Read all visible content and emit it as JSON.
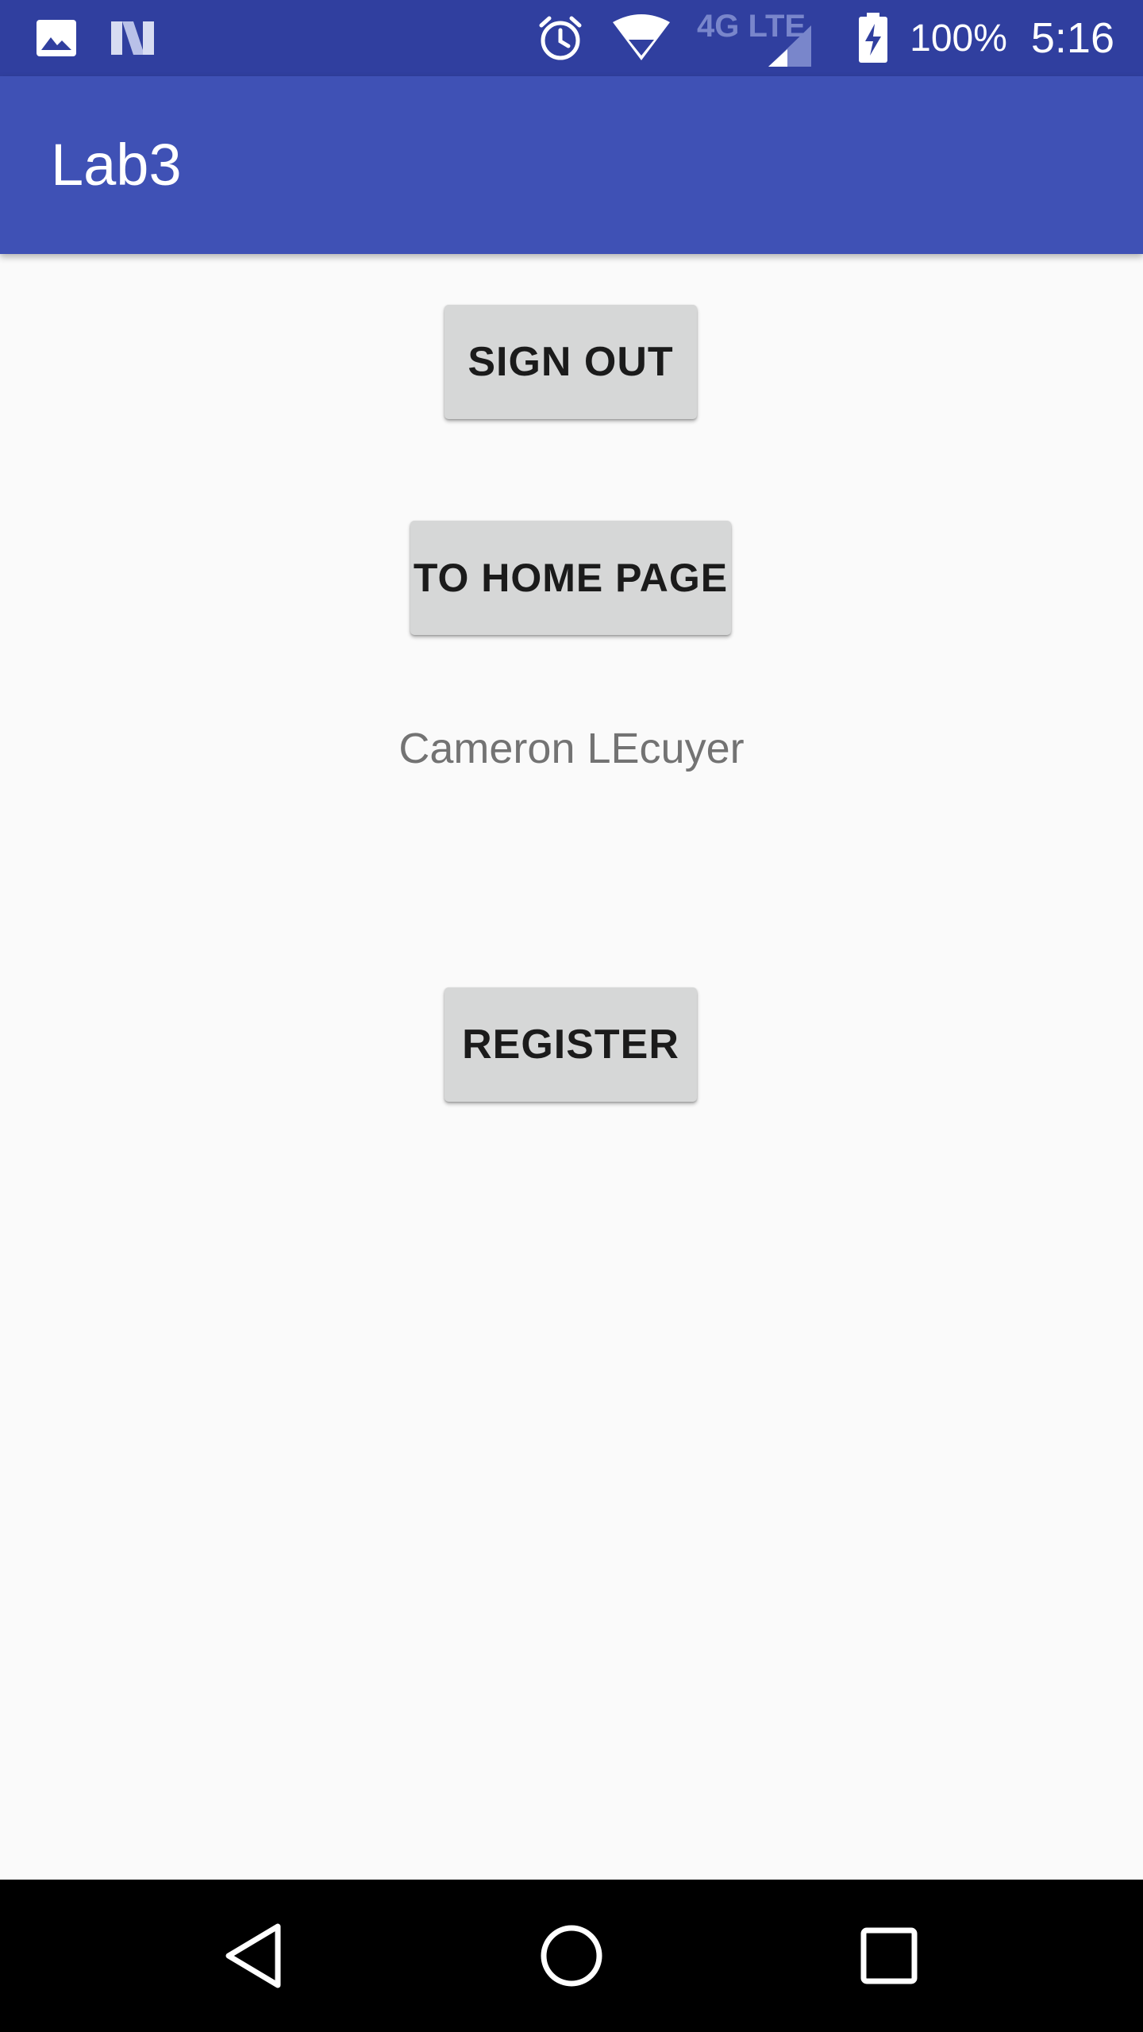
{
  "status_bar": {
    "battery": "100%",
    "time": "5:16",
    "network": "4G LTE",
    "icons": [
      "image-icon",
      "n-notification-icon",
      "alarm-icon",
      "wifi-icon",
      "signal-icon",
      "battery-charging-icon"
    ],
    "background": "#303f9f"
  },
  "app_bar": {
    "title": "Lab3",
    "background": "#3f51b5"
  },
  "main": {
    "sign_out_label": "SIGN OUT",
    "home_page_label": "TO HOME PAGE",
    "user_name": "Cameron LEcuyer",
    "register_label": "REGISTER"
  },
  "nav_bar": {
    "icons": [
      "back-icon",
      "home-icon",
      "recent-apps-icon"
    ]
  }
}
